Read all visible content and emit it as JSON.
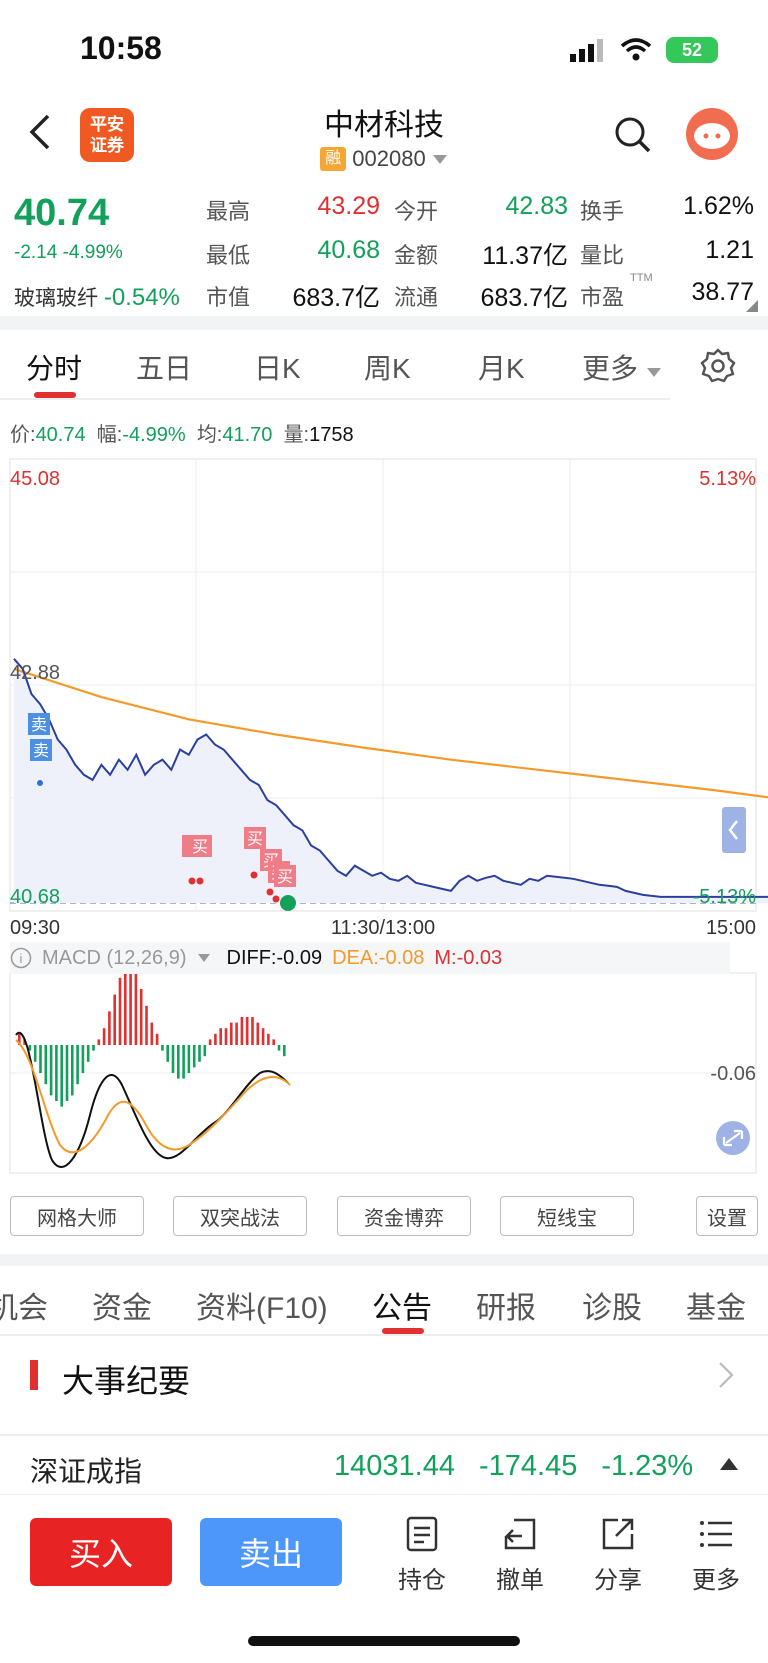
{
  "status": {
    "time": "10:58",
    "battery": "52"
  },
  "header": {
    "logo_text": [
      "平安",
      "证券"
    ],
    "title": "中材科技",
    "badge": "融",
    "code": "002080"
  },
  "quote": {
    "price": "40.74",
    "change": "-2.14  -4.99%",
    "sector_name": "玻璃玻纤",
    "sector_change": "-0.54%",
    "rows": [
      [
        {
          "label": "最高",
          "value": "43.29",
          "color": "red"
        },
        {
          "label": "今开",
          "value": "42.83",
          "color": "green"
        },
        {
          "label": "换手",
          "value": "1.62%",
          "color": "black"
        }
      ],
      [
        {
          "label": "最低",
          "value": "40.68",
          "color": "green"
        },
        {
          "label": "金额",
          "value": "11.37亿",
          "color": "black"
        },
        {
          "label": "量比",
          "value": "1.21",
          "color": "black"
        }
      ],
      [
        {
          "label": "市值",
          "value": "683.7亿",
          "color": "black"
        },
        {
          "label": "流通",
          "value": "683.7亿",
          "color": "black"
        },
        {
          "label": "市盈",
          "value": "38.77",
          "color": "black",
          "sup": "TTM"
        }
      ]
    ]
  },
  "tabs": [
    "分时",
    "五日",
    "日K",
    "周K",
    "月K",
    "更多"
  ],
  "info": {
    "price_label": "价:",
    "price": "40.74",
    "amp_label": "幅:",
    "amp": "-4.99%",
    "avg_label": "均:",
    "avg": "41.70",
    "vol_label": "量:",
    "vol": "1758"
  },
  "chart_data": [
    {
      "type": "line",
      "title": "",
      "y_labels_left": [
        "45.08",
        "42.88",
        "40.68"
      ],
      "y_labels_right": [
        "5.13%",
        "-5.13%"
      ],
      "x_labels": [
        "09:30",
        "11:30/13:00",
        "15:00"
      ],
      "ylim": [
        40.68,
        45.08
      ],
      "prev_close": 42.88,
      "series": [
        {
          "color": "#2b3f9e",
          "x": [
            0,
            1,
            2,
            3,
            4,
            5,
            6,
            7,
            8,
            9,
            10,
            11,
            12,
            13,
            14,
            15,
            16,
            17,
            18,
            19,
            20,
            21,
            22,
            23,
            24,
            25,
            26,
            27,
            28,
            29,
            30,
            31,
            32,
            33,
            34,
            35,
            36,
            37,
            38,
            39,
            40,
            41,
            42,
            43,
            44,
            45,
            46,
            47,
            48,
            49,
            50,
            51,
            52,
            53,
            54,
            55,
            56,
            57,
            58,
            59,
            60,
            61,
            62,
            63,
            64,
            65,
            66,
            67,
            68,
            69,
            70,
            71,
            72,
            73,
            74,
            75,
            76,
            77,
            78,
            79,
            80,
            81,
            82,
            83,
            84,
            85,
            86,
            87,
            88,
            89,
            90
          ],
          "values": [
            43.1,
            43.0,
            42.75,
            42.65,
            42.5,
            42.3,
            42.2,
            42.05,
            41.95,
            41.9,
            42.05,
            41.95,
            42.1,
            42.0,
            42.15,
            41.95,
            42.05,
            42.1,
            42.0,
            42.2,
            42.15,
            42.3,
            42.35,
            42.25,
            42.2,
            42.1,
            42.0,
            41.9,
            41.85,
            41.7,
            41.65,
            41.55,
            41.45,
            41.4,
            41.25,
            41.2,
            41.1,
            41.0,
            40.95,
            41.05,
            41.0,
            40.95,
            40.98,
            40.92,
            40.9,
            40.95,
            40.88,
            40.86,
            40.84,
            40.82,
            40.8,
            40.9,
            40.95,
            40.9,
            40.93,
            40.95,
            40.9,
            40.88,
            40.86,
            40.92,
            40.9,
            40.95,
            40.94,
            40.93,
            40.92,
            40.9,
            40.88,
            40.86,
            40.85,
            40.84,
            40.8,
            40.78,
            40.76,
            40.75,
            40.74,
            40.74,
            40.74,
            40.74,
            40.74,
            40.74,
            40.74,
            40.74,
            40.74,
            40.74,
            40.74,
            40.74,
            40.74,
            40.74,
            40.74,
            40.74,
            40.74
          ]
        },
        {
          "color": "#f39a2b",
          "x": [
            0,
            10,
            20,
            30,
            40,
            50,
            60,
            70,
            80,
            87
          ],
          "values": [
            43.0,
            42.72,
            42.5,
            42.35,
            42.22,
            42.1,
            42.0,
            41.9,
            41.8,
            41.72
          ]
        }
      ],
      "annotations": [
        "卖",
        "卖",
        "买",
        "买",
        "买",
        "买",
        "买"
      ]
    },
    {
      "type": "bar",
      "title": "MACD",
      "params": "(12,26,9)",
      "diff_label": "DIFF:",
      "diff": "-0.09",
      "dea_label": "DEA:",
      "dea": "-0.08",
      "m_label": "M:",
      "m": "-0.03",
      "y_label": "-0.06",
      "histogram": [
        0.02,
        0.01,
        -0.01,
        -0.03,
        -0.05,
        -0.07,
        -0.09,
        -0.1,
        -0.11,
        -0.1,
        -0.09,
        -0.07,
        -0.05,
        -0.03,
        -0.01,
        0.01,
        0.03,
        0.06,
        0.09,
        0.12,
        0.14,
        0.15,
        0.13,
        0.1,
        0.07,
        0.04,
        0.02,
        -0.01,
        -0.03,
        -0.05,
        -0.06,
        -0.06,
        -0.05,
        -0.04,
        -0.03,
        -0.02,
        0.01,
        0.02,
        0.03,
        0.03,
        0.04,
        0.04,
        0.05,
        0.05,
        0.05,
        0.04,
        0.03,
        0.02,
        0.01,
        -0.01,
        -0.02
      ]
    }
  ],
  "macd_label": "MACD (12,26,9)",
  "tools": [
    "网格大师",
    "双突战法",
    "资金博弈",
    "短线宝",
    "设置"
  ],
  "news_tabs": [
    "机会",
    "资金",
    "资料(F10)",
    "公告",
    "研报",
    "诊股",
    "基金"
  ],
  "event_title": "大事纪要",
  "index": {
    "name": "深证成指",
    "value": "14031.44",
    "change": "-174.45",
    "pct": "-1.23%"
  },
  "bottom": {
    "buy": "买入",
    "sell": "卖出",
    "hold": "持仓",
    "cancel": "撤单",
    "share": "分享",
    "more": "更多"
  }
}
